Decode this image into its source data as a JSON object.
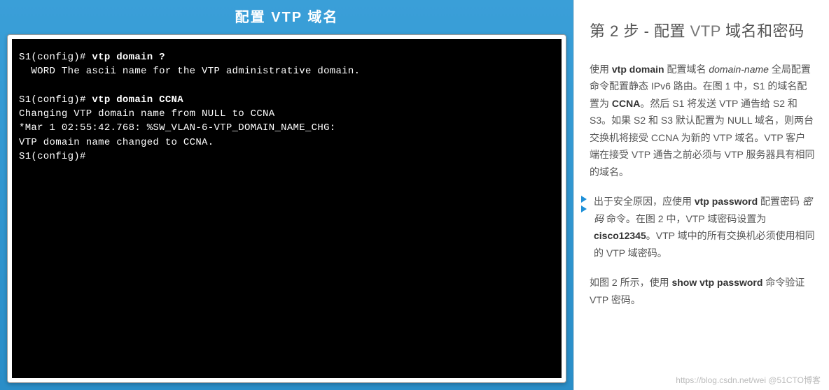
{
  "slide": {
    "title": "配置 VTP 域名"
  },
  "terminal": {
    "l1_prompt": "S1(config)# ",
    "l1_cmd": "vtp domain ?",
    "l2": "  WORD The ascii name for the VTP administrative domain.",
    "blankA": "",
    "l3_prompt": "S1(config)# ",
    "l3_cmd": "vtp domain CCNA",
    "l4": "Changing VTP domain name from NULL to CCNA",
    "l5": "*Mar 1 02:55:42.768: %SW_VLAN-6-VTP_DOMAIN_NAME_CHG:",
    "l6": "VTP domain name changed to CCNA.",
    "l7": "S1(config)#"
  },
  "sidebar": {
    "heading_a": "第 2 步 - 配置 ",
    "heading_b": "VTP",
    "heading_c": " 域名和密码",
    "p1": {
      "a": "使用 ",
      "cmd1": "vtp domain",
      "b": " 配置域名 ",
      "em": "domain-name",
      "c": " 全局配置命令配置静态 IPv6 路由。在图 1 中，S1 的域名配置为 ",
      "bold": "CCNA",
      "d": "。然后 S1 将发送 VTP 通告给 S2 和 S3。如果 S2 和 S3 默认配置为 NULL 域名，则两台交换机将接受 CCNA 为新的 VTP 域名。VTP 客户端在接受 VTP 通告之前必须与 VTP 服务器具有相同的域名。"
    },
    "p2": {
      "a": "出于安全原因，应使用 ",
      "cmd": "vtp password",
      "b": " 配置密码 ",
      "em": "密码",
      "c": " 命令。在图 2 中，VTP 域密码设置为 ",
      "bold": "cisco12345",
      "d": "。VTP 域中的所有交换机必须使用相同的 VTP 域密码。"
    },
    "p3": {
      "a": "如图 2 所示，使用 ",
      "cmd": "show vtp password",
      "b": " 命令验证 VTP 密码。"
    }
  },
  "watermark": "https://blog.csdn.net/wei @51CTO博客"
}
